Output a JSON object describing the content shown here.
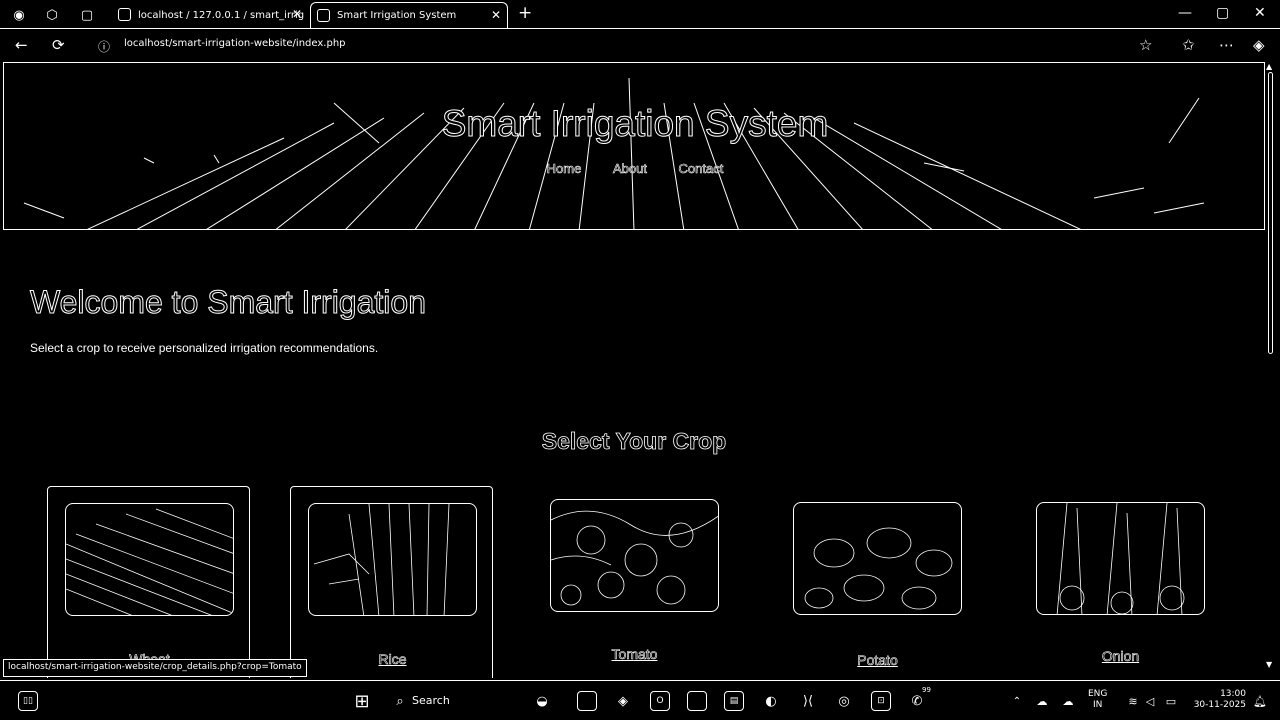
{
  "browser": {
    "tabs": [
      {
        "label": "localhost / 127.0.0.1 / smart_irrig",
        "active": false
      },
      {
        "label": "Smart Irrigation System",
        "active": true
      }
    ],
    "url": "localhost/smart-irrigation-website/index.php",
    "status_url": "localhost/smart-irrigation-website/crop_details.php?crop=Tomato"
  },
  "hero": {
    "title": "Smart Irrigation System",
    "nav": [
      "Home",
      "About",
      "Contact"
    ]
  },
  "welcome": {
    "title": "Welcome to Smart Irrigation",
    "subtitle": "Select a crop to receive personalized irrigation recommendations."
  },
  "crops": {
    "title": "Select Your Crop",
    "items": [
      {
        "name": "Wheat"
      },
      {
        "name": "Rice"
      },
      {
        "name": "Tomato"
      },
      {
        "name": "Potato"
      },
      {
        "name": "Onion"
      }
    ]
  },
  "taskbar": {
    "search": "Search",
    "lang_top": "ENG",
    "lang_bottom": "IN",
    "time": "13:00",
    "date": "30-11-2025",
    "notif_count": "99"
  }
}
